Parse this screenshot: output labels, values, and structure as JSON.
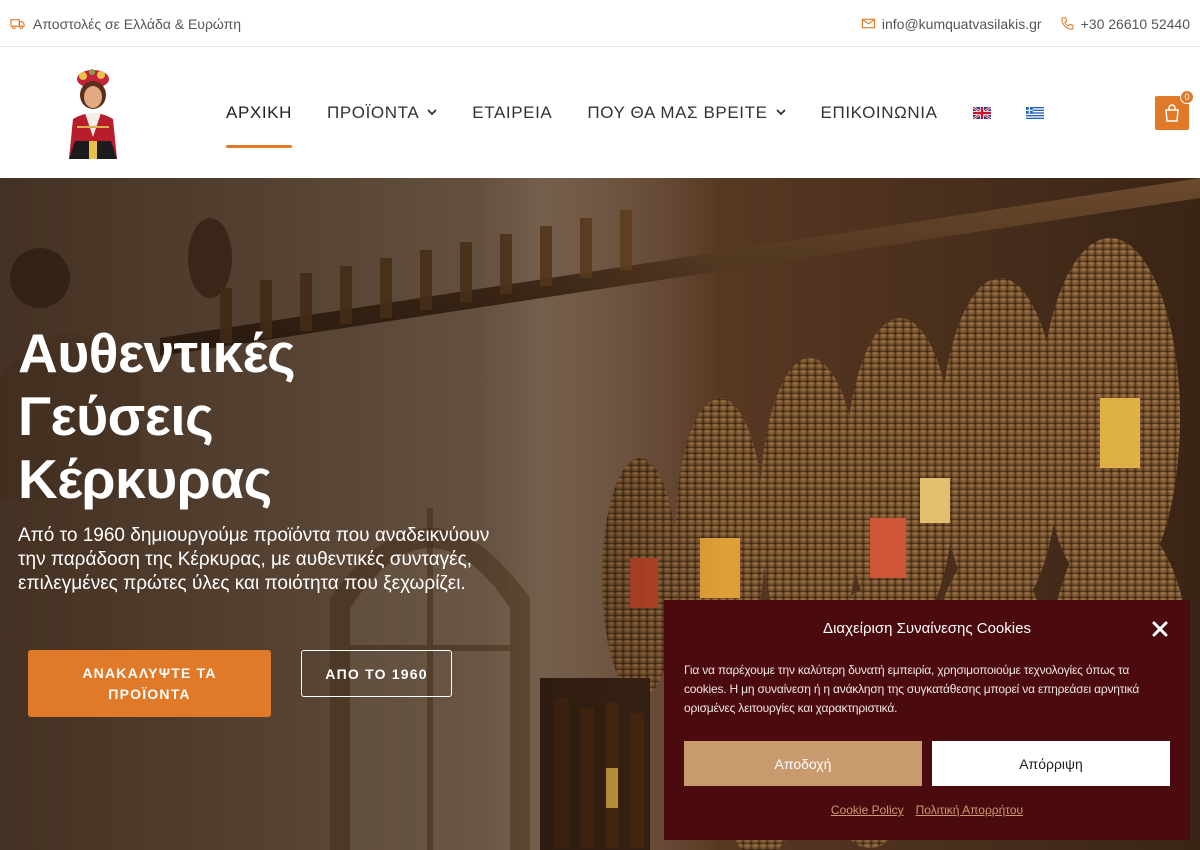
{
  "topbar": {
    "shipping_text": "Αποστολές σε Ελλάδα & Ευρώπη",
    "email": "info@kumquatvasilakis.gr",
    "phone": "+30 26610 52440"
  },
  "nav": {
    "items": [
      {
        "label": "ΑΡΧΙΚΗ",
        "active": true,
        "dropdown": false
      },
      {
        "label": "ΠΡΟΪΟΝΤΑ",
        "active": false,
        "dropdown": true
      },
      {
        "label": "ΕΤΑΙΡΕΙΑ",
        "active": false,
        "dropdown": false
      },
      {
        "label": "ΠΟΥ ΘΑ ΜΑΣ ΒΡΕΙΤΕ",
        "active": false,
        "dropdown": true
      },
      {
        "label": "ΕΠΙΚΟΙΝΩΝΙΑ",
        "active": false,
        "dropdown": false
      }
    ],
    "languages": [
      "en-flag-icon",
      "gr-flag-icon"
    ]
  },
  "cart": {
    "count": "0"
  },
  "hero": {
    "title_line1": "Αυθεντικές",
    "title_line2": "Γεύσεις",
    "title_line3": "Κέρκυρας",
    "text": "Από το 1960 δημιουργούμε προϊόντα που αναδεικνύουν την παράδοση της Κέρκυρας, με αυθεντικές συνταγές, επιλεγμένες πρώτες ύλες και ποιότητα που ξεχωρίζει.",
    "primary_button": "ΑΝΑΚΑΛΥΨΤΕ ΤΑ ΠΡΟΪΟΝΤΑ",
    "secondary_button": "ΑΠΟ ΤΟ 1960"
  },
  "cookie": {
    "title": "Διαχείριση Συναίνεσης Cookies",
    "text": "Για να παρέχουμε την καλύτερη δυνατή εμπειρία, χρησιμοποιούμε τεχνολογίες όπως τα cookies. Η μη συναίνεση ή η ανάκληση της συγκατάθεσης μπορεί να επηρεάσει αρνητικά ορισμένες λειτουργίες και χαρακτηριστικά.",
    "accept": "Αποδοχή",
    "reject": "Απόρριψη",
    "link_policy": "Cookie Policy",
    "link_privacy": "Πολιτική Απορρήτου"
  },
  "colors": {
    "accent": "#e07a28",
    "cookie_bg": "#4b0b0e",
    "cookie_accent": "#c99a6e"
  }
}
